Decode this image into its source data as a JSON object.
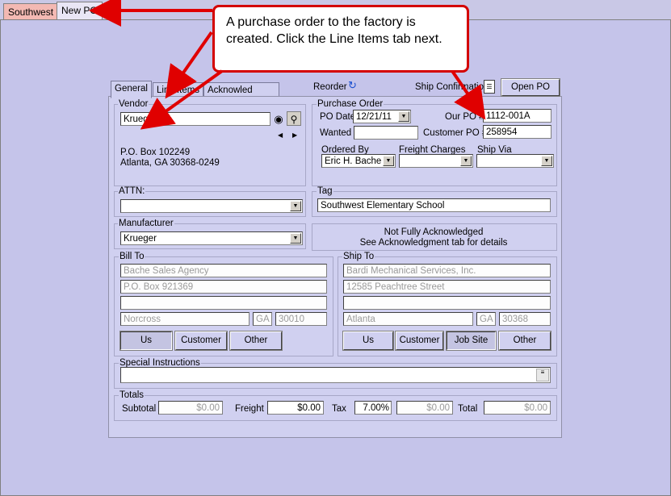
{
  "top_tabs": [
    "Southwest",
    "New PO"
  ],
  "sub_tabs": [
    "General",
    "Line Items",
    "Acknowled"
  ],
  "reorder_label": "Reorder",
  "ship_confirmation_label": "Ship Confirmation",
  "open_po_label": "Open PO",
  "callout": "A purchase order to the factory is created. Click the Line Items tab next.",
  "vendor": {
    "title": "Vendor",
    "value": "Krueger",
    "address_line1": "P.O. Box 102249",
    "address_line2": "Atlanta, GA 30368-0249"
  },
  "purchase_order": {
    "title": "Purchase Order",
    "po_date_label": "PO Date",
    "po_date": "12/21/11",
    "our_po_label": "Our PO #",
    "our_po": "1112-001A",
    "wanted_label": "Wanted",
    "wanted": "",
    "customer_po_label": "Customer PO #",
    "customer_po": "258954",
    "ordered_by_label": "Ordered By",
    "ordered_by": "Eric H. Bache",
    "freight_charges_label": "Freight Charges",
    "freight_charges": "",
    "ship_via_label": "Ship Via",
    "ship_via": ""
  },
  "attn": {
    "title": "ATTN:",
    "value": ""
  },
  "tag": {
    "title": "Tag",
    "value": "Southwest Elementary School"
  },
  "manufacturer": {
    "title": "Manufacturer",
    "value": "Krueger"
  },
  "ack_status": {
    "line1": "Not Fully Acknowledged",
    "line2": "See Acknowledgment tab for details"
  },
  "bill_to": {
    "title": "Bill To",
    "name": "Bache Sales Agency",
    "address1": "P.O. Box 921369",
    "address2": "",
    "city": "Norcross",
    "state": "GA",
    "zip": "30010",
    "buttons": [
      "Us",
      "Customer",
      "Other"
    ]
  },
  "ship_to": {
    "title": "Ship To",
    "name": "Bardi Mechanical Services, Inc.",
    "address1": "12585 Peachtree Street",
    "address2": "",
    "city": "Atlanta",
    "state": "GA",
    "zip": "30368",
    "buttons": [
      "Us",
      "Customer",
      "Job Site",
      "Other"
    ]
  },
  "special_instructions": {
    "title": "Special Instructions",
    "value": ""
  },
  "totals": {
    "title": "Totals",
    "subtotal_label": "Subtotal",
    "subtotal": "$0.00",
    "freight_label": "Freight",
    "freight": "$0.00",
    "tax_label": "Tax",
    "tax_rate": "7.00",
    "tax_pct_sign": "%",
    "tax": "$0.00",
    "total_label": "Total",
    "total": "$0.00"
  },
  "colors": {
    "callout_border": "#d40000",
    "arrow": "#e00000",
    "panel": "#d0d0f0",
    "background": "#c5c4ea"
  }
}
